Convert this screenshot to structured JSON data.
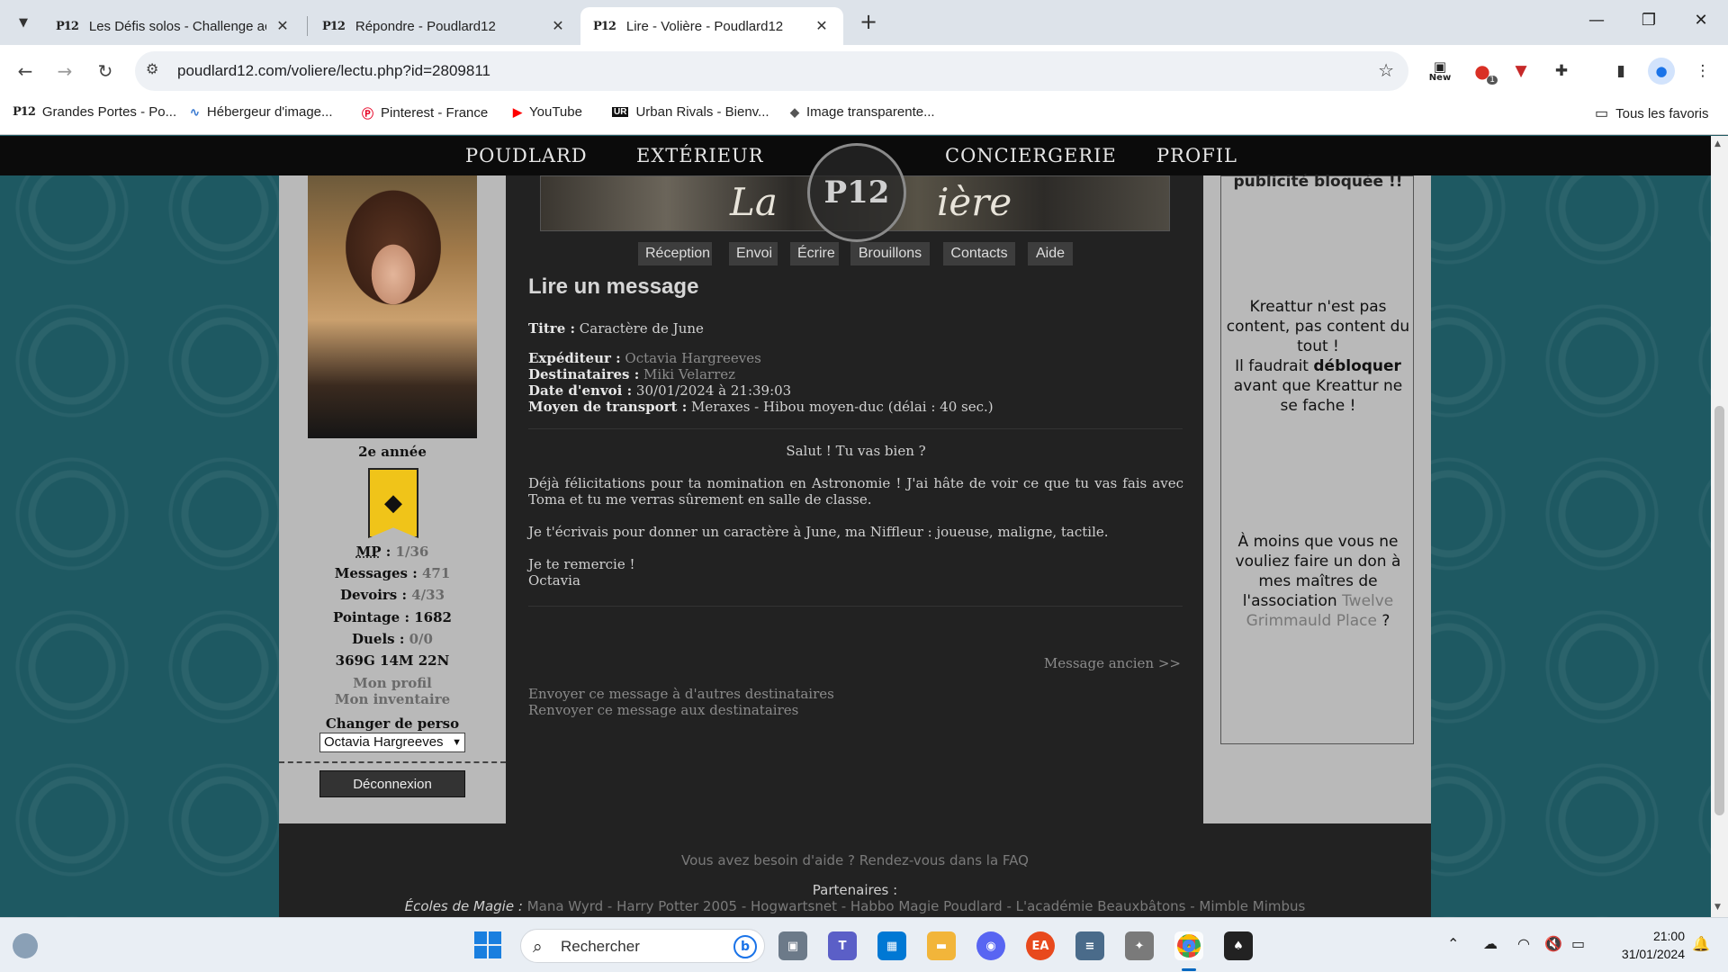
{
  "browser": {
    "tabs": [
      {
        "favicon": "P12",
        "title": "Les Défis solos - Challenge acce"
      },
      {
        "favicon": "P12",
        "title": "Répondre - Poudlard12"
      },
      {
        "favicon": "P12",
        "title": "Lire - Volière - Poudlard12"
      }
    ],
    "url": "poudlard12.com/voliere/lectu.php?id=2809811",
    "extensions": {
      "new_label": "New",
      "badge_count": "1"
    },
    "bookmarks": [
      {
        "icon": "P12",
        "label": "Grandes Portes - Po..."
      },
      {
        "icon": "image-host-icon",
        "label": "Hébergeur d'image..."
      },
      {
        "icon": "pinterest-icon",
        "label": "Pinterest - France"
      },
      {
        "icon": "youtube-icon",
        "label": "YouTube"
      },
      {
        "icon": "UR",
        "label": "Urban Rivals - Bienv..."
      },
      {
        "icon": "layers-icon",
        "label": "Image transparente..."
      }
    ],
    "all_bookmarks": "Tous les favoris"
  },
  "site": {
    "nav": [
      "POUDLARD",
      "EXTÉRIEUR",
      "CONCIERGERIE",
      "PROFIL"
    ],
    "logo_text": "P12",
    "banner_text_left": "La",
    "banner_text_right": "ière",
    "subnav": [
      "Réception",
      "Envoi",
      "Écrire",
      "Brouillons",
      "Contacts",
      "Aide"
    ]
  },
  "profile": {
    "year": "2e année",
    "stats": [
      {
        "label": "MP",
        "value": "1/36"
      },
      {
        "label": "Messages",
        "value": "471"
      },
      {
        "label": "Devoirs",
        "value": "4/33"
      },
      {
        "label": "Pointage",
        "value": "1682"
      },
      {
        "label": "Duels",
        "value": "0/0"
      }
    ],
    "money": "369G 14M 22N",
    "links": [
      "Mon profil",
      "Mon inventaire"
    ],
    "switch_label": "Changer de perso",
    "selected_character": "Octavia Hargreeves",
    "logout": "Déconnexion"
  },
  "message": {
    "heading": "Lire un message",
    "title_label": "Titre :",
    "title": "Caractère de June",
    "sender_label": "Expéditeur :",
    "sender": "Octavia Hargreeves",
    "recipients_label": "Destinataires :",
    "recipients": "Miki Velarrez",
    "date_label": "Date d'envoi :",
    "date": "30/01/2024 à 21:39:03",
    "transport_label": "Moyen de transport :",
    "transport": "Meraxes - Hibou moyen-duc (délai : 40 sec.)",
    "body": {
      "greeting": "Salut ! Tu vas bien ?",
      "p1": "Déjà félicitations pour ta nomination en Astronomie ! J'ai hâte de voir ce que tu vas fais avec Toma et tu me verras sûrement en salle de classe.",
      "p2": "Je t'écrivais pour donner un caractère à June, ma Niffleur : joueuse, maligne, tactile.",
      "closing": "Je te remercie !",
      "signature": "Octavia"
    },
    "older_link": "Message ancien >>",
    "actions": [
      "Envoyer ce message à d'autres destinataires",
      "Renvoyer ce message aux destinataires"
    ]
  },
  "sidebar_ad": {
    "top_text": "publicité bloquée !!",
    "p1_a": "Kreattur n'est pas content, pas content du tout !",
    "p1_b": "Il faudrait",
    "p1_bold": "débloquer",
    "p1_c": "avant que Kreattur ne se fache !",
    "p2_a": "À moins que vous ne vouliez faire un don à mes maîtres de l'association",
    "p2_link": "Twelve Grimmauld Place",
    "p2_end": "?"
  },
  "footer": {
    "help": "Vous avez besoin d'aide ? Rendez-vous dans la FAQ",
    "partners_label": "Partenaires :",
    "schools_label": "Écoles de Magie :",
    "schools": "Mana Wyrd - Harry Potter 2005 - Hogwartsnet - Habbo Magie Poudlard - L'académie Beauxbâtons - Mimble Mimbus"
  },
  "taskbar": {
    "search_placeholder": "Rechercher",
    "time": "21:00",
    "date": "31/01/2024"
  }
}
